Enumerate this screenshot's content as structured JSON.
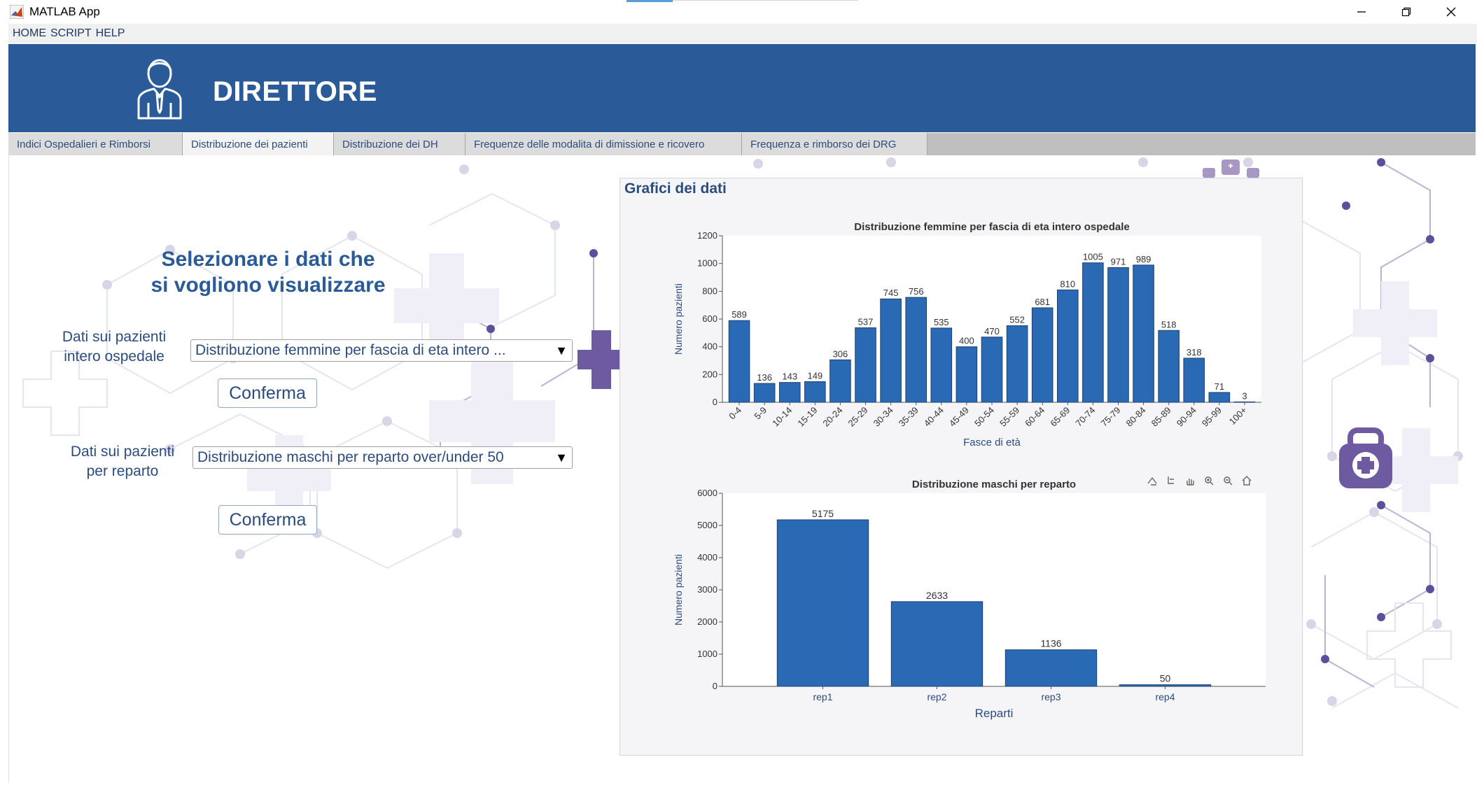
{
  "window": {
    "title": "MATLAB App"
  },
  "menu": [
    {
      "label": "HOME"
    },
    {
      "label": "SCRIPT"
    },
    {
      "label": "HELP"
    }
  ],
  "header": {
    "title": "DIRETTORE"
  },
  "tabs": [
    {
      "label": "Indici Ospedalieri e Rimborsi"
    },
    {
      "label": "Distribuzione dei pazienti"
    },
    {
      "label": "Distribuzione dei DH"
    },
    {
      "label": "Frequenze delle modalita di dimissione e ricovero"
    },
    {
      "label": "Frequenza e rimborso dei DRG"
    }
  ],
  "left": {
    "title_line1": "Selezionare i dati che",
    "title_line2": "si vogliono visualizzare",
    "label1_line1": "Dati sui pazienti",
    "label1_line2": "intero ospedale",
    "dropdown1": "Distribuzione femmine per fascia di eta intero ...",
    "button1": "Conferma",
    "label2_line1": "Dati sui pazienti",
    "label2_line2": "per reparto",
    "dropdown2": "Distribuzione maschi per reparto over/under 50",
    "button2": "Conferma"
  },
  "panel": {
    "title": "Grafici dei dati"
  },
  "colors": {
    "header": "#2a5a97",
    "bar": "#2a6ab5",
    "accent": "#6e5aa0"
  },
  "chart_data": [
    {
      "type": "bar",
      "title": "Distribuzione femmine per fascia di eta intero ospedale",
      "xlabel": "Fasce di età",
      "ylabel": "Numero pazienti",
      "ylim": [
        0,
        1200
      ],
      "yticks": [
        0,
        200,
        400,
        600,
        800,
        1000,
        1200
      ],
      "categories": [
        "0-4",
        "5-9",
        "10-14",
        "15-19",
        "20-24",
        "25-29",
        "30-34",
        "35-39",
        "40-44",
        "45-49",
        "50-54",
        "55-59",
        "60-64",
        "65-69",
        "70-74",
        "75-79",
        "80-84",
        "85-89",
        "90-94",
        "95-99",
        "100+"
      ],
      "values": [
        589,
        136,
        143,
        149,
        306,
        537,
        745,
        756,
        535,
        400,
        470,
        552,
        681,
        810,
        1005,
        971,
        989,
        518,
        318,
        71,
        3
      ],
      "grid": false
    },
    {
      "type": "bar",
      "title": "Distribuzione maschi per reparto",
      "xlabel": "Reparti",
      "ylabel": "Numero pazienti",
      "ylim": [
        0,
        6000
      ],
      "yticks": [
        0,
        1000,
        2000,
        3000,
        4000,
        5000,
        6000
      ],
      "categories": [
        "rep1",
        "rep2",
        "rep3",
        "rep4"
      ],
      "values": [
        5175,
        2633,
        1136,
        50
      ],
      "grid": false
    }
  ]
}
